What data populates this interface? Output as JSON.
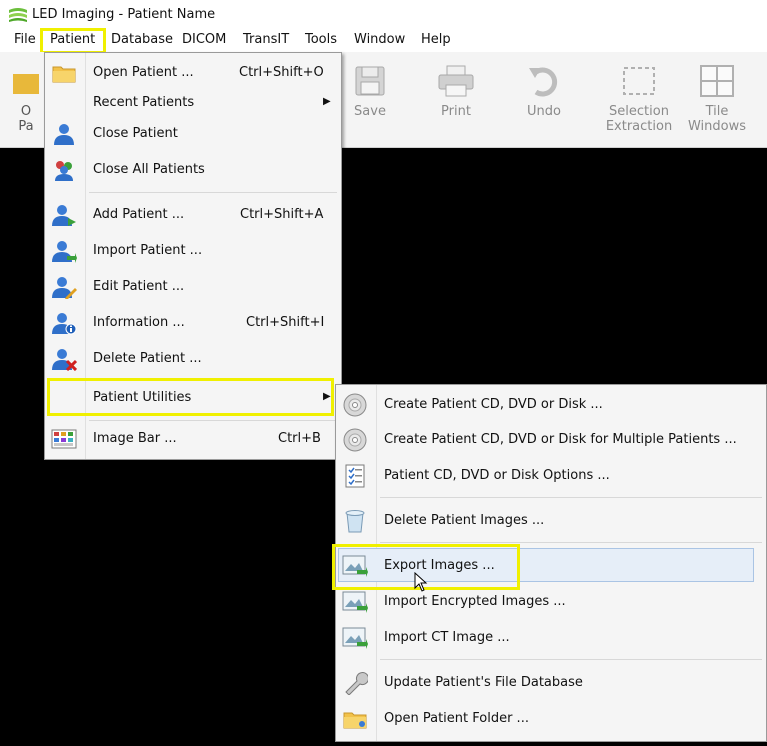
{
  "window": {
    "title": "LED Imaging -  Patient Name"
  },
  "menubar": {
    "items": [
      "File",
      "Patient",
      "Database",
      "DICOM",
      "TransIT",
      "Tools",
      "Window",
      "Help"
    ]
  },
  "toolbar": {
    "partial_label_line1": "O",
    "partial_label_line2": "Pa",
    "buttons": [
      {
        "label": "Save"
      },
      {
        "label": "Print"
      },
      {
        "label": "Undo"
      },
      {
        "label1": "Selection",
        "label2": "Extraction"
      },
      {
        "label1": "Tile",
        "label2": "Windows"
      }
    ]
  },
  "patient_menu": {
    "items": [
      {
        "label": "Open Patient ...",
        "shortcut": "Ctrl+Shift+O",
        "icon": "folder-icon"
      },
      {
        "label": "Recent Patients",
        "icon": "none"
      },
      {
        "label": "Close Patient",
        "icon": "user-icon"
      },
      {
        "label": "Close All Patients",
        "icon": "users-icon"
      },
      {
        "label": "Add Patient ...",
        "shortcut": "Ctrl+Shift+A",
        "icon": "user-add-icon"
      },
      {
        "label": "Import Patient ...",
        "icon": "user-import-icon"
      },
      {
        "label": "Edit Patient ...",
        "icon": "user-edit-icon"
      },
      {
        "label": "Information ...",
        "shortcut": "Ctrl+Shift+I",
        "icon": "user-info-icon"
      },
      {
        "label": "Delete Patient ...",
        "icon": "user-delete-icon"
      },
      {
        "label": "Patient Utilities",
        "icon": "none"
      },
      {
        "label": "Image Bar ...",
        "shortcut": "Ctrl+B",
        "icon": "image-bar-icon"
      }
    ]
  },
  "utilities_menu": {
    "items": [
      {
        "label": "Create Patient CD, DVD or Disk ...",
        "icon": "disc-icon"
      },
      {
        "label": "Create Patient CD, DVD or Disk for Multiple Patients ...",
        "icon": "disc-icon"
      },
      {
        "label": "Patient CD, DVD or Disk Options ...",
        "icon": "checklist-icon"
      },
      {
        "label": "Delete Patient Images ...",
        "icon": "trash-icon"
      },
      {
        "label": "Export Images ...",
        "icon": "image-export-icon"
      },
      {
        "label": "Import Encrypted Images ...",
        "icon": "image-import-icon"
      },
      {
        "label": "Import CT Image ...",
        "icon": "image-import-icon"
      },
      {
        "label": "Update Patient's File Database",
        "icon": "wrench-icon"
      },
      {
        "label": "Open Patient Folder ...",
        "icon": "folder-icon"
      }
    ]
  },
  "colors": {
    "highlight": "#f0f000",
    "menu_bg": "#f5f5f5",
    "user_blue": "#2f6fc9"
  }
}
